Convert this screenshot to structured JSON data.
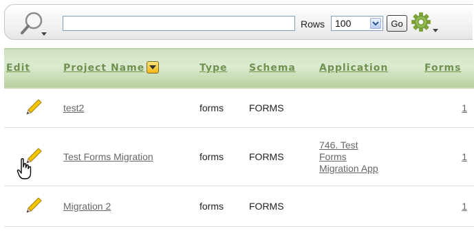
{
  "search": {
    "value": "",
    "placeholder": ""
  },
  "rows": {
    "label": "Rows",
    "selected": "100"
  },
  "toolbar": {
    "go_label": "Go"
  },
  "table": {
    "headers": {
      "edit": "Edit",
      "project_name": "Project Name",
      "type": "Type",
      "schema": "Schema",
      "application": "Application",
      "forms": "Forms"
    },
    "rows": [
      {
        "project_name": "test2",
        "type": "forms",
        "schema": "FORMS",
        "application": [
          "",
          "",
          ""
        ],
        "forms": "1"
      },
      {
        "project_name": "Test Forms Migration",
        "type": "forms",
        "schema": "FORMS",
        "application": [
          "746. Test",
          "Forms",
          "Migration App"
        ],
        "forms": "1"
      },
      {
        "project_name": "Migration 2",
        "type": "forms",
        "schema": "FORMS",
        "application": [
          "",
          "",
          ""
        ],
        "forms": "1"
      }
    ]
  },
  "colors": {
    "header_text": "#6f9250",
    "header_bg": "#cfe0c0",
    "link": "#666666",
    "sort_button": "#f2b817"
  },
  "icons": {
    "search": "magnifier-icon",
    "actions": "gear-icon",
    "edit": "pencil-icon",
    "cursor": "hand-pointer-icon"
  }
}
